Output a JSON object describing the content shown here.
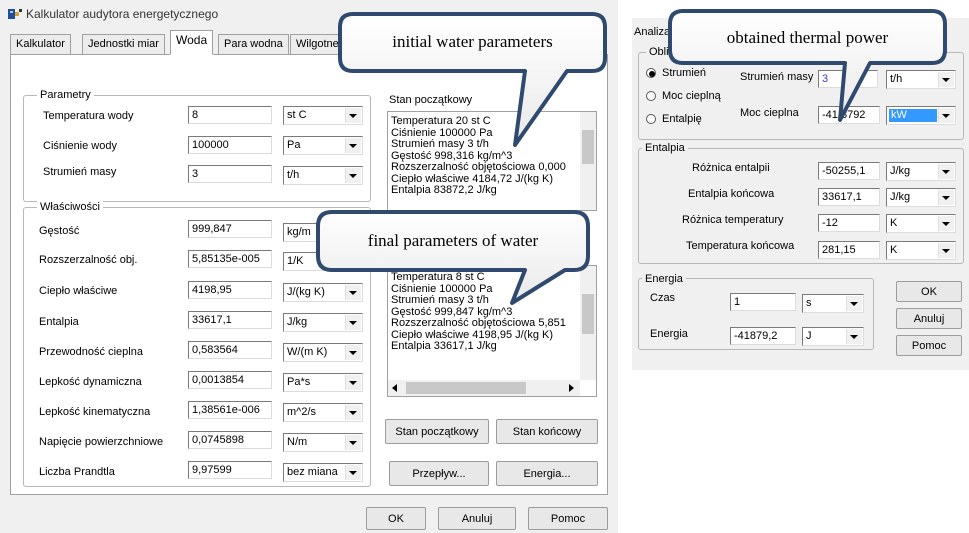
{
  "left_window": {
    "title": "Kalkulator audytora energetycznego",
    "tabs": [
      {
        "label": "Kalkulator"
      },
      {
        "label": "Jednostki miar"
      },
      {
        "label": "Woda"
      },
      {
        "label": "Para wodna"
      },
      {
        "label": "Wilgotne powietrze"
      }
    ],
    "active_tab": "Woda",
    "params_group": {
      "title": "Parametry",
      "rows": [
        {
          "label": "Temperatura wody",
          "value": "8",
          "unit": "st C"
        },
        {
          "label": "Ciśnienie wody",
          "value": "100000",
          "unit": "Pa"
        },
        {
          "label": "Strumień masy",
          "value": "3",
          "unit": "t/h"
        }
      ]
    },
    "props_group": {
      "title": "Właściwości",
      "rows": [
        {
          "label": "Gęstość",
          "value": "999,847",
          "unit": "kg/m"
        },
        {
          "label": "Rozszerzalność obj.",
          "value": "5,85135e-005",
          "unit": "1/K"
        },
        {
          "label": "Ciepło właściwe",
          "value": "4198,95",
          "unit": "J/(kg K)"
        },
        {
          "label": "Entalpia",
          "value": "33617,1",
          "unit": "J/kg"
        },
        {
          "label": "Przewodność cieplna",
          "value": "0,583564",
          "unit": "W/(m K)"
        },
        {
          "label": "Lepkość dynamiczna",
          "value": "0,0013854",
          "unit": "Pa*s"
        },
        {
          "label": "Lepkość kinematyczna",
          "value": "1,38561e-006",
          "unit": "m^2/s"
        },
        {
          "label": "Napięcie powierzchniowe",
          "value": "0,0745898",
          "unit": "N/m"
        },
        {
          "label": "Liczba Prandtla",
          "value": "9,97599",
          "unit": "bez miana"
        }
      ]
    },
    "initial_state": {
      "title": "Stan początkowy",
      "lines": [
        "Temperatura 20 st C",
        "Ciśnienie 100000 Pa",
        "Strumień masy 3 t/h",
        "Gęstość 998,316 kg/m^3",
        "Rozszerzalność objętościowa 0,000",
        "Ciepło właściwe 4184,72 J/(kg K)",
        "Entalpia 83872,2 J/kg"
      ]
    },
    "final_state": {
      "lines": [
        "Temperatura 8 st C",
        "Ciśnienie 100000 Pa",
        "Strumień masy 3 t/h",
        "Gęstość 999,847 kg/m^3",
        "Rozszerzalność objętościowa 5,851",
        "Ciepło właściwe 4198,95 J/(kg K)",
        "Entalpia 33617,1 J/kg"
      ]
    },
    "buttons": {
      "stan_poczatkowy": "Stan początkowy",
      "stan_koncowy": "Stan końcowy",
      "przeplyw": "Przepływ...",
      "energia": "Energia...",
      "ok": "OK",
      "anuluj": "Anuluj",
      "pomoc": "Pomoc"
    }
  },
  "right_window": {
    "title": "Analiza",
    "calc_group": {
      "title": "Obli",
      "options": [
        {
          "label": "Strumień",
          "selected": true
        },
        {
          "label": "Moc cieplną",
          "selected": false
        },
        {
          "label": "Entalpię",
          "selected": false
        }
      ],
      "mass_flow_label": "Strumień masy",
      "mass_flow_value": "3",
      "mass_flow_unit": "t/h",
      "heat_power_label": "Moc cieplna",
      "heat_power_value": "-41,8792",
      "heat_power_unit": "kW"
    },
    "enthalpy_group": {
      "title": "Entalpia",
      "rows": [
        {
          "label": "Różnica entalpii",
          "value": "-50255,1",
          "unit": "J/kg"
        },
        {
          "label": "Entalpia końcowa",
          "value": "33617,1",
          "unit": "J/kg"
        },
        {
          "label": "Różnica temperatury",
          "value": "-12",
          "unit": "K"
        },
        {
          "label": "Temperatura końcowa",
          "value": "281,15",
          "unit": "K"
        }
      ]
    },
    "energy_group": {
      "title": "Energia",
      "time_label": "Czas",
      "time_value": "1",
      "time_unit": "s",
      "energy_label": "Energia",
      "energy_value": "-41879,2",
      "energy_unit": "J"
    },
    "buttons": {
      "ok": "OK",
      "anuluj": "Anuluj",
      "pomoc": "Pomoc"
    }
  },
  "callouts": {
    "initial": "initial water parameters",
    "final": "final parameters of water",
    "power": "obtained thermal power"
  }
}
